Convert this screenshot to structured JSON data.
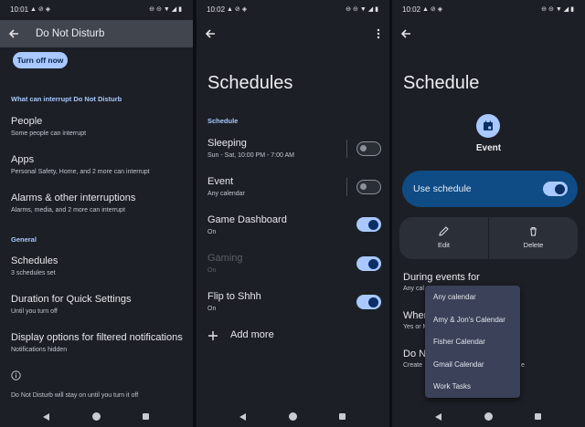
{
  "screen1": {
    "status_time": "10:01",
    "title": "Do Not Disturb",
    "turn_off_label": "Turn off now",
    "section_interrupt": "What can interrupt Do Not Disturb",
    "items": [
      {
        "title": "People",
        "subtitle": "Some people can interrupt"
      },
      {
        "title": "Apps",
        "subtitle": "Personal Safety, Home, and 2 more can interrupt"
      },
      {
        "title": "Alarms & other interruptions",
        "subtitle": "Alarms, media, and 2 more can interrupt"
      }
    ],
    "section_general": "General",
    "general_items": [
      {
        "title": "Schedules",
        "subtitle": "3 schedules set"
      },
      {
        "title": "Duration for Quick Settings",
        "subtitle": "Until you turn off"
      },
      {
        "title": "Display options for filtered notifications",
        "subtitle": "Notifications hidden"
      }
    ],
    "footer_note": "Do Not Disturb will stay on until you turn it off"
  },
  "screen2": {
    "status_time": "10:02",
    "title": "Schedules",
    "section": "Schedule",
    "schedules": [
      {
        "title": "Sleeping",
        "subtitle": "Sun - Sat, 10:00 PM - 7:00 AM",
        "on": false,
        "dimmed": false
      },
      {
        "title": "Event",
        "subtitle": "Any calendar",
        "on": false,
        "dimmed": false
      },
      {
        "title": "Game Dashboard",
        "subtitle": "On",
        "on": true,
        "dimmed": false
      },
      {
        "title": "Gaming",
        "subtitle": "On",
        "on": true,
        "dimmed": true
      },
      {
        "title": "Flip to Shhh",
        "subtitle": "On",
        "on": true,
        "dimmed": false
      }
    ],
    "add_more_label": "Add more"
  },
  "screen3": {
    "status_time": "10:02",
    "title": "Schedule",
    "event_label": "Event",
    "use_schedule_label": "Use schedule",
    "use_schedule_on": true,
    "edit_label": "Edit",
    "delete_label": "Delete",
    "during_events_title": "During events for",
    "during_events_sub": "Any cal",
    "where_title": "Wher",
    "where_sub": "Yes or M",
    "do_not_title": "Do N",
    "do_not_sub": "Create",
    "do_not_sub_tail": "e",
    "dropdown_options": [
      "Any calendar",
      "Amy & Jon's Calendar",
      "Fisher Calendar",
      "Gmail Calendar",
      "Work Tasks"
    ]
  },
  "colors": {
    "accent": "#a8c8ff",
    "surface": "#1c1f25",
    "blue_card": "#0f4b85",
    "dropdown": "#3a4158"
  }
}
